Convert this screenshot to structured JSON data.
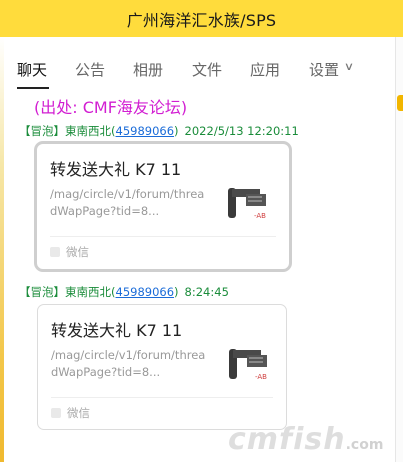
{
  "window": {
    "title": "广州海洋汇水族/SPS"
  },
  "tabs": [
    {
      "label": "聊天",
      "active": true
    },
    {
      "label": "公告"
    },
    {
      "label": "相册"
    },
    {
      "label": "文件"
    },
    {
      "label": "应用"
    },
    {
      "label": "设置",
      "has_dropdown": true
    }
  ],
  "source_note": "(出处: CMF海友论坛)",
  "messages": [
    {
      "tag": "【冒泡】",
      "nick": "東南西北(",
      "qq": "45989066",
      "nick_close": ")",
      "time": "2022/5/13 12:20:11",
      "card": {
        "title": "转发送大礼 K7 11",
        "url": "/mag/circle/v1/forum/threadWapPage?tid=8...",
        "app": "微信",
        "thumb_icon": "desk-lamp-icon",
        "selected": true
      }
    },
    {
      "tag": "【冒泡】",
      "nick": "東南西北(",
      "qq": "45989066",
      "nick_close": ")",
      "time": "8:24:45",
      "card": {
        "title": "转发送大礼 K7 11",
        "url": "/mag/circle/v1/forum/threadWapPage?tid=8...",
        "app": "微信",
        "thumb_icon": "desk-lamp-icon",
        "selected": false
      }
    }
  ],
  "watermark": {
    "main": "cmfish",
    "suffix": ".com"
  },
  "colors": {
    "titlebar": "#ffdc3c",
    "source_note": "#d21ed2",
    "nick": "#1a8c3a",
    "qq_link": "#1a6bd8"
  }
}
